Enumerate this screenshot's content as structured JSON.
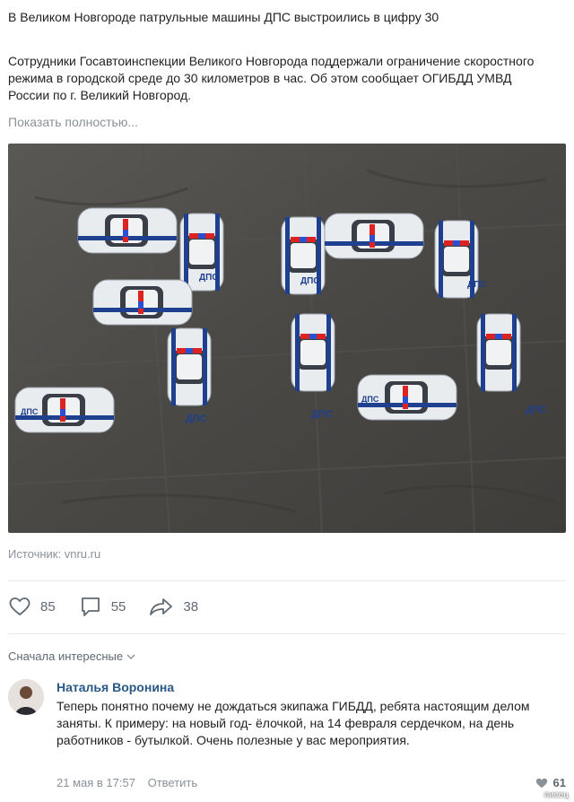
{
  "post": {
    "title": "В Великом Новгороде патрульные машины ДПС выстроились в цифру 30",
    "text": "Сотрудники Госавтоинспекции Великого Новгорода поддержали ограничение скоростного режима в городской среде до 30 километров в час. Об этом сообщает ОГИБДД УМВД России по г. Великий Новгород.",
    "show_more": "Показать полностью...",
    "car_label": "ДПС",
    "source": "Источник: vnru.ru"
  },
  "actions": {
    "likes": "85",
    "comments": "55",
    "shares": "38"
  },
  "comments_sort": "Сначала интересные",
  "comment": {
    "author": "Наталья Воронина",
    "text": "Теперь понятно почему не дождаться экипажа ГИБДД, ребята настоящим делом заняты. К примеру: на новый год- ёлочкой, на 14 февраля сердечком, на день работников - бутылкой. Очень полезные у вас мероприятия.",
    "date": "21 мая в 17:57",
    "reply": "Ответить",
    "likes": "61"
  },
  "watermark": "писец",
  "icons": {
    "like": "heart-icon",
    "comment": "comment-icon",
    "share": "share-arrow-icon",
    "sort": "chevron-down-icon"
  },
  "colors": {
    "link": "#2a5885",
    "muted": "#8a9199",
    "icon": "#5f6873",
    "stripe": "#1f3f8f"
  }
}
